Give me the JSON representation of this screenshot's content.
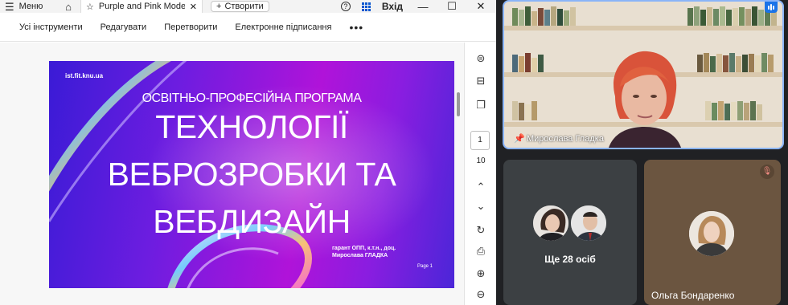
{
  "viewer": {
    "menu_label": "Меню",
    "tab_title": "Purple and Pink Mode...",
    "tab_close": "✕",
    "create_label": "Створити",
    "login_label": "Вхід",
    "window_minimize": "—",
    "window_maximize": "☐",
    "window_close": "✕",
    "toolbar": {
      "all_tools": "Усі інструменти",
      "edit": "Редагувати",
      "convert": "Перетворити",
      "esign": "Електронне підписання",
      "more": "•••"
    },
    "slide": {
      "site": "ist.fit.knu.ua",
      "kicker": "ОСВІТНЬО-ПРОФЕСІЙНА ПРОГРАМА",
      "title_line1": "ТЕХНОЛОГІЇ",
      "title_line2": "ВЕБРОЗРОБКИ ТА",
      "title_line3": "ВЕБДИЗАЙН",
      "guarantor_line1": "гарант ОПП, к.т.н., доц.",
      "guarantor_line2": "Мирослава ГЛАДКА",
      "page_label": "Page 1"
    },
    "page_current": "1",
    "page_total": "10"
  },
  "meeting": {
    "speaker_name": "Мирослава Гладка",
    "others_label": "Ще 28 осіб",
    "participant_name": "Ольга Бондаренко"
  },
  "colors": {
    "speaker_border": "#8ab4f8",
    "tile_bg": "#3c4043",
    "olga_tile_bg": "#6b5540",
    "slide_gradient_start": "#3a1bd6",
    "slide_gradient_mid": "#b013d9"
  }
}
